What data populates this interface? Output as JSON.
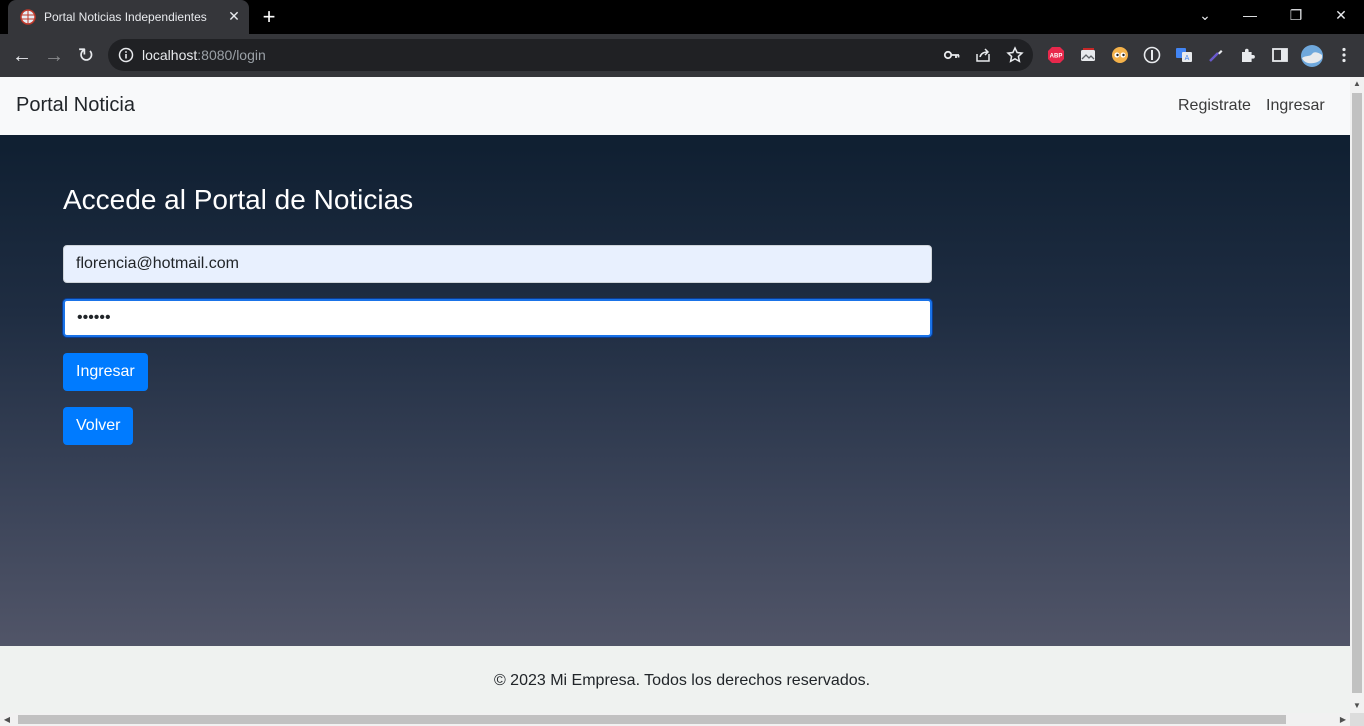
{
  "browser": {
    "tab_title": "Portal Noticias Independientes",
    "tab_close": "✕",
    "new_tab": "+",
    "url_host": "localhost",
    "url_path": ":8080/login",
    "window_controls": {
      "tab_search": "⌄",
      "minimize": "—",
      "restore": "❐",
      "close": "✕"
    },
    "nav": {
      "back": "←",
      "forward": "→",
      "reload": "↻"
    },
    "extensions": [
      "abp-icon",
      "gallery-icon",
      "eyes-icon",
      "privacy-icon",
      "translate-icon",
      "eyedropper-icon",
      "puzzle-icon",
      "sidepanel-icon",
      "profile-avatar",
      "kebab-menu-icon"
    ],
    "colors": {
      "tabstrip": "#000000",
      "toolbar": "#35363a",
      "omnibox": "#202124"
    }
  },
  "navbar": {
    "brand": "Portal Noticia",
    "links": [
      "Registrate",
      "Ingresar"
    ]
  },
  "login": {
    "heading": "Accede al Portal de Noticias",
    "email_value": "florencia@hotmail.com",
    "password_value": "••••••",
    "submit_label": "Ingresar",
    "back_label": "Volver"
  },
  "footer": {
    "text": "© 2023 Mi Empresa. Todos los derechos reservados."
  },
  "colors": {
    "primary_button": "#007bff",
    "hero_gradient_top": "#0f1f31",
    "hero_gradient_bottom": "#515568",
    "navbar_bg": "#f8f9fa",
    "footer_bg": "#eff2f0"
  }
}
